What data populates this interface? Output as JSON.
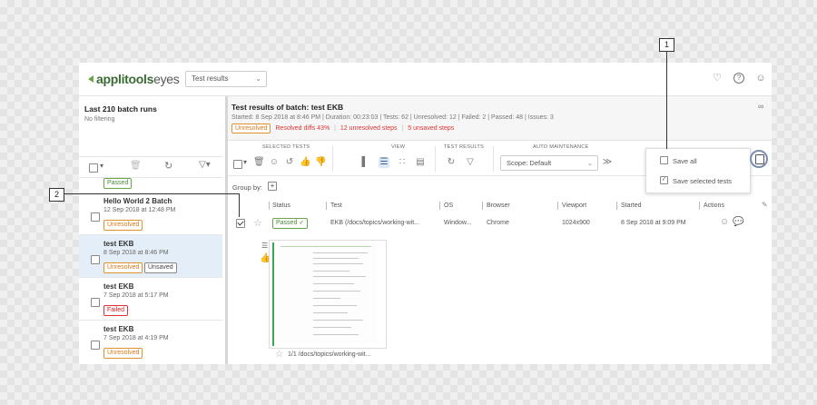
{
  "app": {
    "logo_main": "applitools",
    "logo_sub": "eyes",
    "view_select": "Test results"
  },
  "header_icons": [
    "bell-icon",
    "help-icon",
    "user-settings-icon"
  ],
  "left_panel": {
    "title": "Last 210 batch runs",
    "subtitle": "No filtering",
    "top_badge": "Passed",
    "batches": [
      {
        "name": "Hello World 2 Batch",
        "date": "12 Sep 2018 at 12:48 PM",
        "badges": [
          "Unresolved"
        ]
      },
      {
        "name": "test EKB",
        "date": "8 Sep 2018 at 8:46 PM",
        "badges": [
          "Unresolved",
          "Unsaved"
        ],
        "selected": true
      },
      {
        "name": "test EKB",
        "date": "7 Sep 2018 at 5:17 PM",
        "badges": [
          "Failed"
        ]
      },
      {
        "name": "test EKB",
        "date": "7 Sep 2018 at 4:19 PM",
        "badges": [
          "Unresolved"
        ]
      }
    ]
  },
  "batch_info": {
    "title": "Test results of batch: test EKB",
    "stats": "Started: 8 Sep 2018 at 8:46 PM  |  Duration: 00:23:03  |  Tests: 62  |  Unresolved: 12  |  Failed: 2  |  Passed: 48  |  Issues: 3",
    "status_badge": "Unresolved",
    "resolved": "Resolved diffs 43%",
    "unresolved_steps": "12 unresolved steps",
    "unsaved_steps": "5 unsaved steps"
  },
  "toolbar": {
    "selected_tests": "SELECTED TESTS",
    "view": "VIEW",
    "test_results": "TEST RESULTS",
    "auto_maintenance": "AUTO MAINTENANCE",
    "scope": "Scope: Default"
  },
  "group_by": "Group by:",
  "columns": [
    "Status",
    "Test",
    "OS",
    "Browser",
    "Viewport",
    "Started",
    "Actions"
  ],
  "row": {
    "status": "Passed",
    "test": "EKB (/docs/topics/working-wit...",
    "os": "Window...",
    "browser": "Chrome",
    "viewport": "1024x900",
    "started": "8 Sep 2018 at 9:09 PM"
  },
  "thumbnail_caption": "1/1 /docs/topics/working-wit...",
  "save_menu": {
    "save_all": "Save all",
    "save_selected": "Save selected tests"
  },
  "callouts": {
    "one": "1",
    "two": "2"
  },
  "colors": {
    "accent_green": "#6aa54a",
    "warning": "#e0922e",
    "error": "#dd3333"
  }
}
